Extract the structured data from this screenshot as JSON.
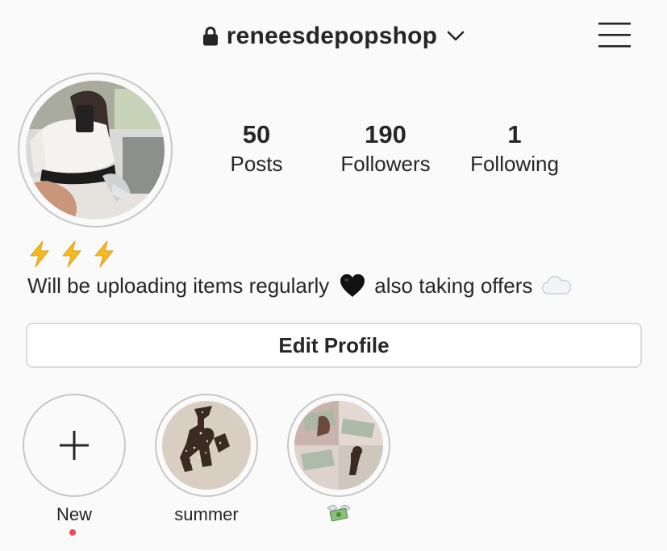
{
  "header": {
    "username": "reneesdepopshop",
    "lock_icon": "lock-icon",
    "dropdown_icon": "chevron-down-icon",
    "menu_icon": "hamburger-menu-icon"
  },
  "profile": {
    "avatar_icon": "profile-photo",
    "stats": [
      {
        "value": "50",
        "label": "Posts"
      },
      {
        "value": "190",
        "label": "Followers"
      },
      {
        "value": "1",
        "label": "Following"
      }
    ]
  },
  "bio": {
    "emoji_line": [
      "high-voltage-emoji",
      "high-voltage-emoji",
      "high-voltage-emoji"
    ],
    "text_part1": "Will be uploading items regularly",
    "heart_icon": "black-heart-emoji",
    "text_part2": "also taking offers",
    "cloud_icon": "cloud-emoji"
  },
  "edit_profile": {
    "label": "Edit Profile"
  },
  "highlights": [
    {
      "label": "New",
      "icon": "plus-icon",
      "has_new_dot": true
    },
    {
      "label": "summer",
      "icon": "summer-highlight-cover"
    },
    {
      "label": "",
      "label_icon": "money-with-wings-emoji",
      "icon": "money-highlight-cover"
    }
  ],
  "colors": {
    "background": "#fafafa",
    "text": "#262626",
    "border": "#dbdbdb",
    "ring": "#c7c7c7",
    "notification_dot": "#ed4956",
    "bolt": "#f5b921"
  }
}
